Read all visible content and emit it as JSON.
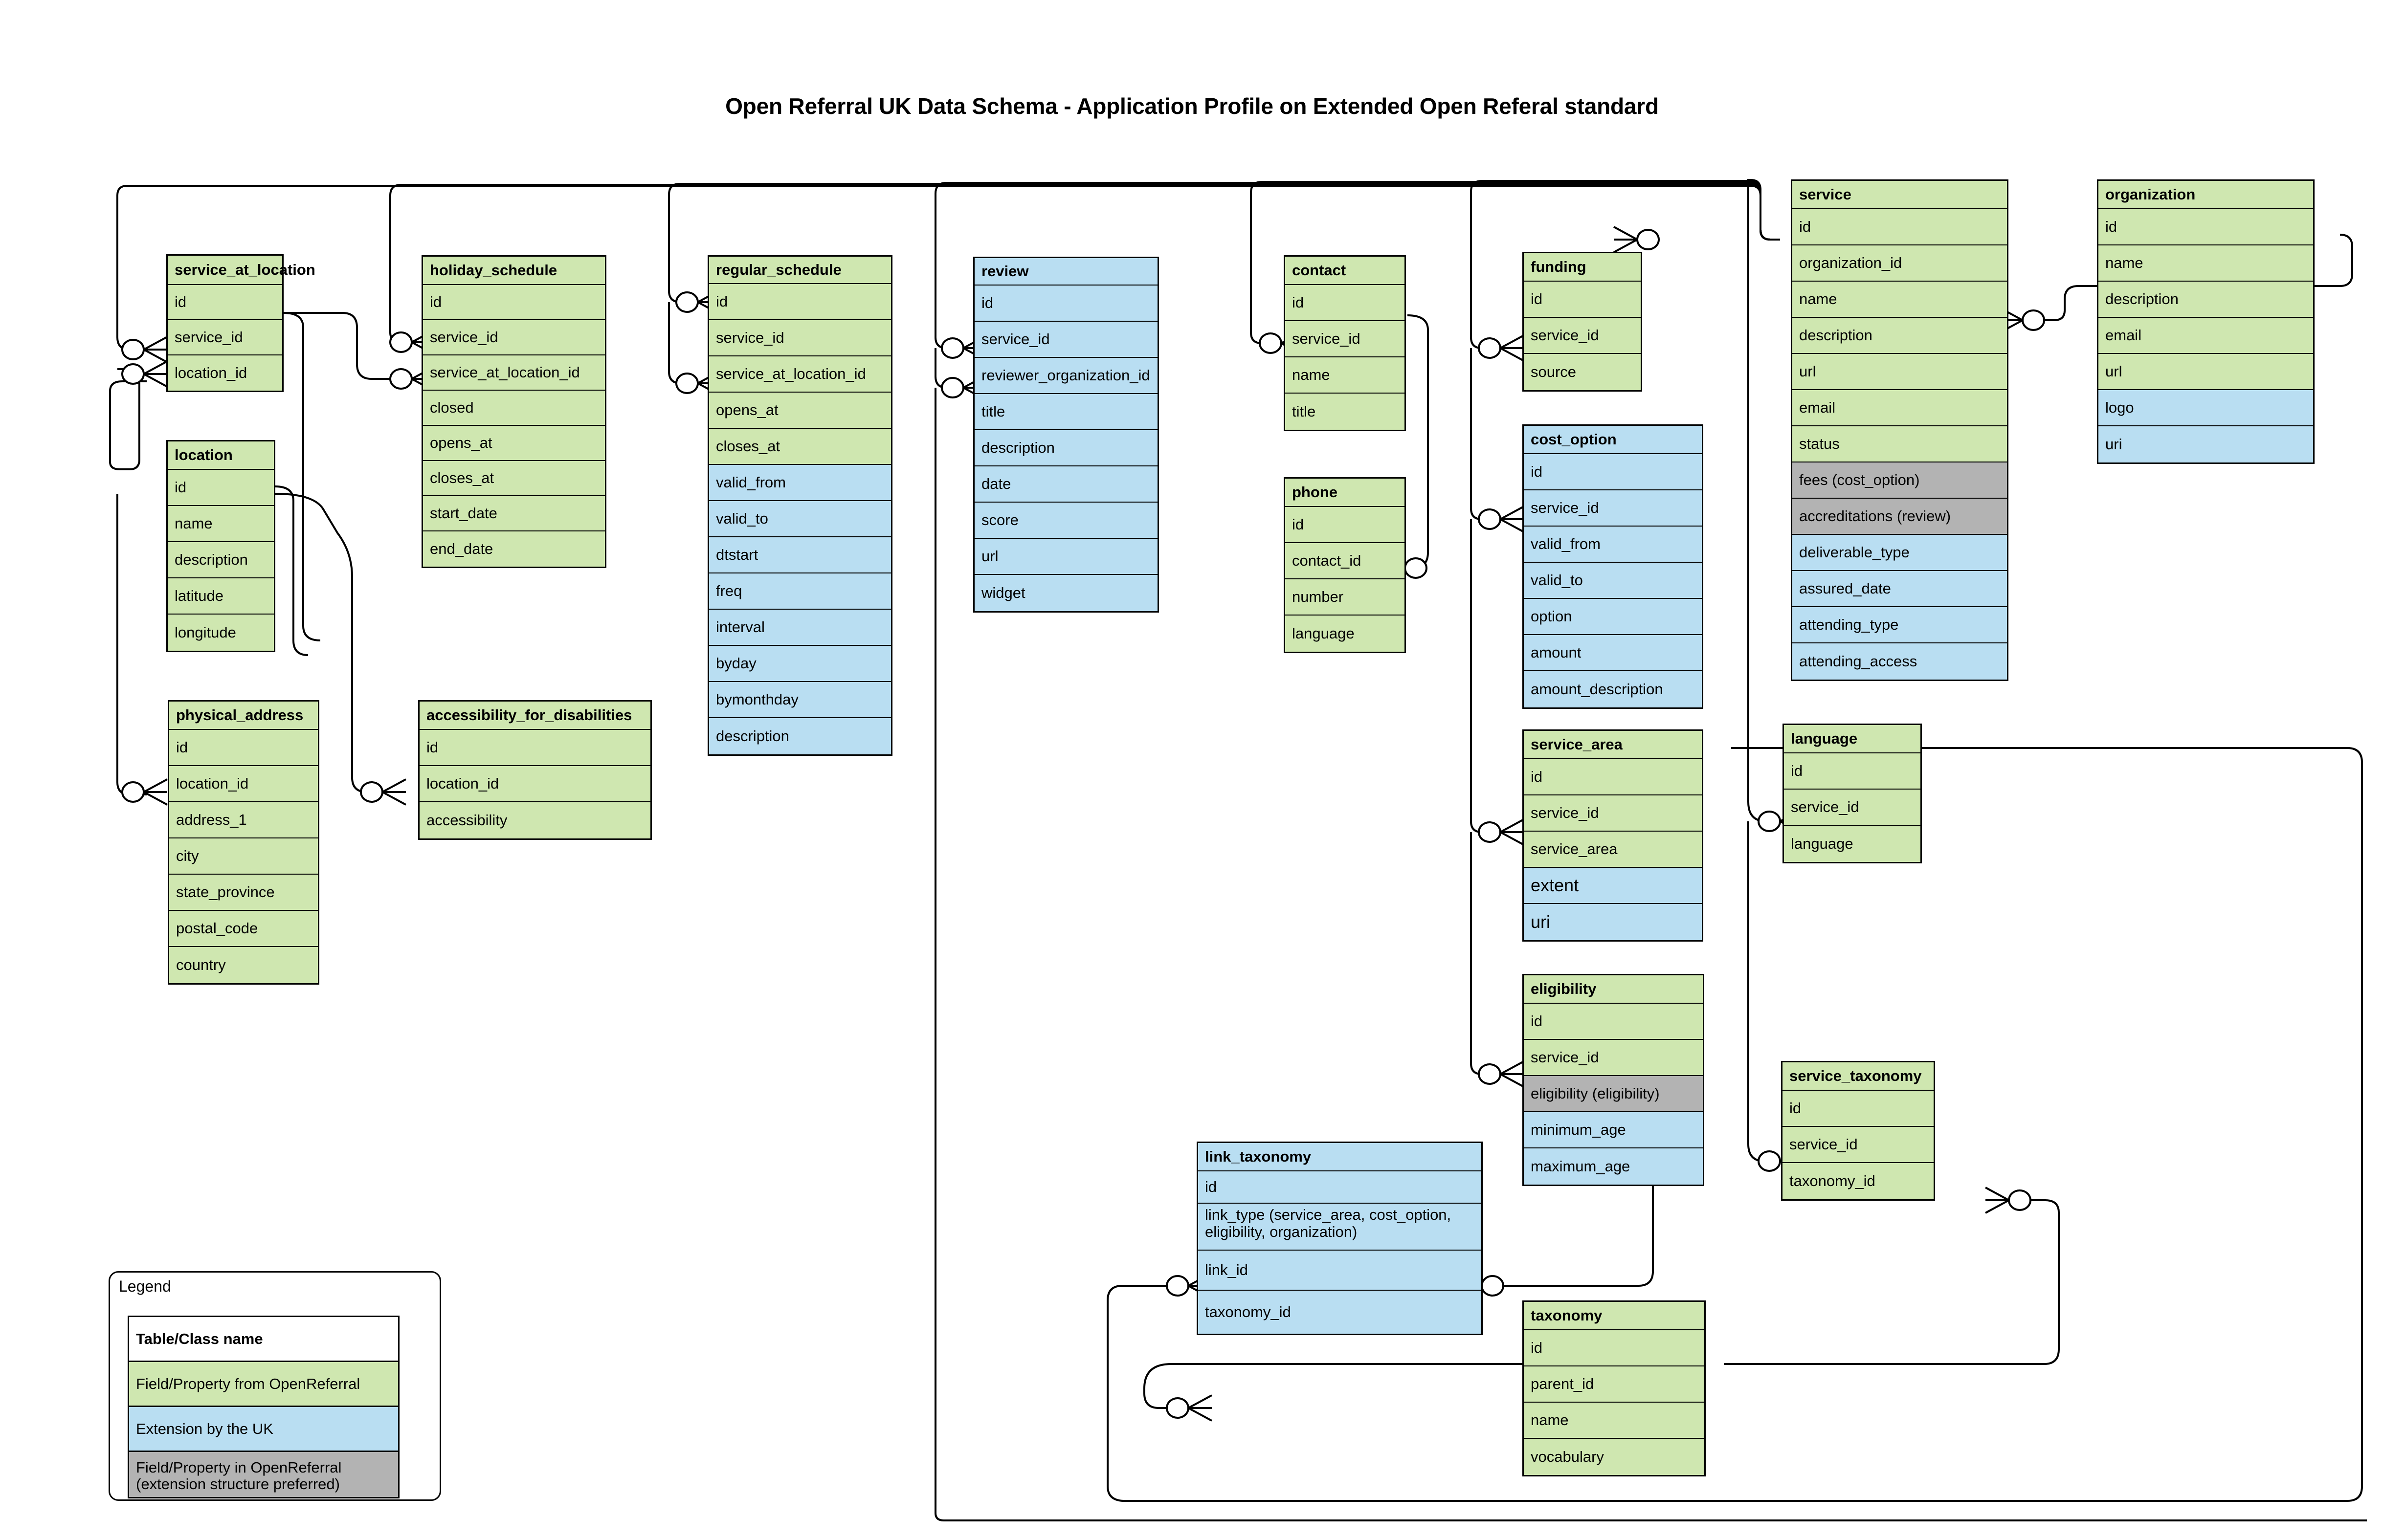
{
  "title": "Open Referral UK Data Schema - Application Profile on Extended Open Referal standard",
  "colors": {
    "openreferral_green": "#cfe7b0",
    "uk_extension_blue": "#b9def2",
    "preferred_gray": "#b3b3b3",
    "stroke": "#000000",
    "background": "#ffffff"
  },
  "legend": {
    "title": "Legend",
    "items": [
      {
        "label": "Table/Class name",
        "swatch": "#ffffff",
        "bold": true
      },
      {
        "label": "Field/Property from OpenReferral",
        "swatch": "#cfe7b0",
        "bold": false
      },
      {
        "label": "Extension by the UK",
        "swatch": "#b9def2",
        "bold": false
      },
      {
        "label": "Field/Property in OpenReferral (extension structure preferred)",
        "swatch": "#b3b3b3",
        "bold": false
      }
    ]
  },
  "entities": [
    {
      "name": "service_at_location",
      "header_fill": "green",
      "fields": [
        {
          "label": "id",
          "fill": "green"
        },
        {
          "label": "service_id",
          "fill": "green"
        },
        {
          "label": "location_id",
          "fill": "green"
        }
      ]
    },
    {
      "name": "location",
      "header_fill": "green",
      "fields": [
        {
          "label": "id",
          "fill": "green"
        },
        {
          "label": "name",
          "fill": "green"
        },
        {
          "label": "description",
          "fill": "green"
        },
        {
          "label": "latitude",
          "fill": "green"
        },
        {
          "label": "longitude",
          "fill": "green"
        }
      ]
    },
    {
      "name": "physical_address",
      "header_fill": "green",
      "fields": [
        {
          "label": "id",
          "fill": "green"
        },
        {
          "label": "location_id",
          "fill": "green"
        },
        {
          "label": "address_1",
          "fill": "green"
        },
        {
          "label": "city",
          "fill": "green"
        },
        {
          "label": "state_province",
          "fill": "green"
        },
        {
          "label": "postal_code",
          "fill": "green"
        },
        {
          "label": "country",
          "fill": "green"
        }
      ]
    },
    {
      "name": "holiday_schedule",
      "header_fill": "green",
      "fields": [
        {
          "label": "id",
          "fill": "green"
        },
        {
          "label": "service_id",
          "fill": "green"
        },
        {
          "label": "service_at_location_id",
          "fill": "green"
        },
        {
          "label": "closed",
          "fill": "green"
        },
        {
          "label": "opens_at",
          "fill": "green"
        },
        {
          "label": "closes_at",
          "fill": "green"
        },
        {
          "label": "start_date",
          "fill": "green"
        },
        {
          "label": "end_date",
          "fill": "green"
        }
      ]
    },
    {
      "name": "accessibility_for_disabilities",
      "header_fill": "green",
      "fields": [
        {
          "label": "id",
          "fill": "green"
        },
        {
          "label": "location_id",
          "fill": "green"
        },
        {
          "label": "accessibility",
          "fill": "green"
        }
      ]
    },
    {
      "name": "regular_schedule",
      "header_fill": "green",
      "fields": [
        {
          "label": "id",
          "fill": "green"
        },
        {
          "label": "service_id",
          "fill": "green"
        },
        {
          "label": "service_at_location_id",
          "fill": "green"
        },
        {
          "label": "opens_at",
          "fill": "green"
        },
        {
          "label": "closes_at",
          "fill": "green"
        },
        {
          "label": "valid_from",
          "fill": "blue"
        },
        {
          "label": "valid_to",
          "fill": "blue"
        },
        {
          "label": "dtstart",
          "fill": "blue"
        },
        {
          "label": "freq",
          "fill": "blue"
        },
        {
          "label": "interval",
          "fill": "blue"
        },
        {
          "label": "byday",
          "fill": "blue"
        },
        {
          "label": "bymonthday",
          "fill": "blue"
        },
        {
          "label": "description",
          "fill": "blue"
        }
      ]
    },
    {
      "name": "review",
      "header_fill": "blue",
      "fields": [
        {
          "label": "id",
          "fill": "blue"
        },
        {
          "label": "service_id",
          "fill": "blue"
        },
        {
          "label": "reviewer_organization_id",
          "fill": "blue"
        },
        {
          "label": "title",
          "fill": "blue"
        },
        {
          "label": "description",
          "fill": "blue"
        },
        {
          "label": "date",
          "fill": "blue"
        },
        {
          "label": "score",
          "fill": "blue"
        },
        {
          "label": "url",
          "fill": "blue"
        },
        {
          "label": "widget",
          "fill": "blue"
        }
      ]
    },
    {
      "name": "contact",
      "header_fill": "green",
      "fields": [
        {
          "label": "id",
          "fill": "green"
        },
        {
          "label": "service_id",
          "fill": "green"
        },
        {
          "label": "name",
          "fill": "green"
        },
        {
          "label": "title",
          "fill": "green"
        }
      ]
    },
    {
      "name": "phone",
      "header_fill": "green",
      "fields": [
        {
          "label": "id",
          "fill": "green"
        },
        {
          "label": "contact_id",
          "fill": "green"
        },
        {
          "label": "number",
          "fill": "green"
        },
        {
          "label": "language",
          "fill": "green"
        }
      ]
    },
    {
      "name": "funding",
      "header_fill": "green",
      "fields": [
        {
          "label": "id",
          "fill": "green"
        },
        {
          "label": "service_id",
          "fill": "green"
        },
        {
          "label": "source",
          "fill": "green"
        }
      ]
    },
    {
      "name": "cost_option",
      "header_fill": "blue",
      "fields": [
        {
          "label": "id",
          "fill": "blue"
        },
        {
          "label": "service_id",
          "fill": "blue"
        },
        {
          "label": "valid_from",
          "fill": "blue"
        },
        {
          "label": "valid_to",
          "fill": "blue"
        },
        {
          "label": "option",
          "fill": "blue"
        },
        {
          "label": "amount",
          "fill": "blue"
        },
        {
          "label": "amount_description",
          "fill": "blue"
        }
      ]
    },
    {
      "name": "service_area",
      "header_fill": "green",
      "fields": [
        {
          "label": "id",
          "fill": "green"
        },
        {
          "label": "service_id",
          "fill": "green"
        },
        {
          "label": "service_area",
          "fill": "green"
        },
        {
          "label": "extent",
          "fill": "blue"
        },
        {
          "label": "uri",
          "fill": "blue"
        }
      ]
    },
    {
      "name": "eligibility",
      "header_fill": "green",
      "fields": [
        {
          "label": "id",
          "fill": "green"
        },
        {
          "label": "service_id",
          "fill": "green"
        },
        {
          "label": "eligibility  (eligibility)",
          "fill": "gray"
        },
        {
          "label": "minimum_age",
          "fill": "blue"
        },
        {
          "label": "maximum_age",
          "fill": "blue"
        }
      ]
    },
    {
      "name": "service",
      "header_fill": "green",
      "fields": [
        {
          "label": "id",
          "fill": "green"
        },
        {
          "label": "organization_id",
          "fill": "green"
        },
        {
          "label": "name",
          "fill": "green"
        },
        {
          "label": "description",
          "fill": "green"
        },
        {
          "label": "url",
          "fill": "green"
        },
        {
          "label": "email",
          "fill": "green"
        },
        {
          "label": "status",
          "fill": "green"
        },
        {
          "label": "fees (cost_option)",
          "fill": "gray"
        },
        {
          "label": "accreditations (review)",
          "fill": "gray"
        },
        {
          "label": "deliverable_type",
          "fill": "blue"
        },
        {
          "label": "assured_date",
          "fill": "blue"
        },
        {
          "label": "attending_type",
          "fill": "blue"
        },
        {
          "label": "attending_access",
          "fill": "blue"
        }
      ]
    },
    {
      "name": "organization",
      "header_fill": "green",
      "fields": [
        {
          "label": "id",
          "fill": "green"
        },
        {
          "label": "name",
          "fill": "green"
        },
        {
          "label": "description",
          "fill": "green"
        },
        {
          "label": "email",
          "fill": "green"
        },
        {
          "label": "url",
          "fill": "green"
        },
        {
          "label": "logo",
          "fill": "blue"
        },
        {
          "label": "uri",
          "fill": "blue"
        }
      ]
    },
    {
      "name": "language",
      "header_fill": "green",
      "fields": [
        {
          "label": "id",
          "fill": "green"
        },
        {
          "label": "service_id",
          "fill": "green"
        },
        {
          "label": "language",
          "fill": "green"
        }
      ]
    },
    {
      "name": "service_taxonomy",
      "header_fill": "green",
      "fields": [
        {
          "label": "id",
          "fill": "green"
        },
        {
          "label": "service_id",
          "fill": "green"
        },
        {
          "label": "taxonomy_id",
          "fill": "green"
        }
      ]
    },
    {
      "name": "link_taxonomy",
      "header_fill": "blue",
      "fields": [
        {
          "label": "id",
          "fill": "blue"
        },
        {
          "label": "link_type (service_area, cost_option, eligibility, organization)",
          "fill": "blue"
        },
        {
          "label": "link_id",
          "fill": "blue"
        },
        {
          "label": "taxonomy_id",
          "fill": "blue"
        }
      ]
    },
    {
      "name": "taxonomy",
      "header_fill": "green",
      "fields": [
        {
          "label": "id",
          "fill": "green"
        },
        {
          "label": "parent_id",
          "fill": "green"
        },
        {
          "label": "name",
          "fill": "green"
        },
        {
          "label": "vocabulary",
          "fill": "green"
        }
      ]
    }
  ],
  "relationships": [
    {
      "from": "service",
      "from_field": "id",
      "to": "service_at_location",
      "to_field": "service_id",
      "type": "one-to-many"
    },
    {
      "from": "location",
      "from_field": "id",
      "to": "service_at_location",
      "to_field": "location_id",
      "type": "one-to-many"
    },
    {
      "from": "location",
      "from_field": "id",
      "to": "physical_address",
      "to_field": "location_id",
      "type": "one-to-many"
    },
    {
      "from": "location",
      "from_field": "id",
      "to": "accessibility_for_disabilities",
      "to_field": "location_id",
      "type": "one-to-many"
    },
    {
      "from": "service",
      "from_field": "id",
      "to": "holiday_schedule",
      "to_field": "service_id",
      "type": "one-to-many"
    },
    {
      "from": "service_at_location",
      "from_field": "id",
      "to": "holiday_schedule",
      "to_field": "service_at_location_id",
      "type": "one-to-many"
    },
    {
      "from": "service",
      "from_field": "id",
      "to": "regular_schedule",
      "to_field": "service_id",
      "type": "one-to-many"
    },
    {
      "from": "service_at_location",
      "from_field": "id",
      "to": "regular_schedule",
      "to_field": "service_at_location_id",
      "type": "one-to-many"
    },
    {
      "from": "service",
      "from_field": "id",
      "to": "review",
      "to_field": "service_id",
      "type": "one-to-many"
    },
    {
      "from": "organization",
      "from_field": "id",
      "to": "review",
      "to_field": "reviewer_organization_id",
      "type": "one-to-many"
    },
    {
      "from": "service",
      "from_field": "id",
      "to": "contact",
      "to_field": "service_id",
      "type": "one-to-many"
    },
    {
      "from": "contact",
      "from_field": "id",
      "to": "phone",
      "to_field": "contact_id",
      "type": "one-to-many"
    },
    {
      "from": "service",
      "from_field": "id",
      "to": "funding",
      "to_field": "service_id",
      "type": "one-to-many"
    },
    {
      "from": "service",
      "from_field": "id",
      "to": "cost_option",
      "to_field": "service_id",
      "type": "one-to-many"
    },
    {
      "from": "service",
      "from_field": "id",
      "to": "service_area",
      "to_field": "service_id",
      "type": "one-to-many"
    },
    {
      "from": "service",
      "from_field": "id",
      "to": "eligibility",
      "to_field": "service_id",
      "type": "one-to-many"
    },
    {
      "from": "service",
      "from_field": "id",
      "to": "language",
      "to_field": "service_id",
      "type": "one-to-many"
    },
    {
      "from": "service",
      "from_field": "id",
      "to": "service_taxonomy",
      "to_field": "service_id",
      "type": "one-to-many"
    },
    {
      "from": "organization",
      "from_field": "id",
      "to": "service",
      "to_field": "organization_id",
      "type": "one-to-many"
    },
    {
      "from": "taxonomy",
      "from_field": "id",
      "to": "service_taxonomy",
      "to_field": "taxonomy_id",
      "type": "one-to-many"
    },
    {
      "from": "taxonomy",
      "from_field": "id",
      "to": "link_taxonomy",
      "to_field": "taxonomy_id",
      "type": "one-to-many"
    },
    {
      "from": "link_taxonomy",
      "from_field": "link_id",
      "to": "service_area",
      "to_field": "id",
      "type": "many-to-one"
    }
  ]
}
